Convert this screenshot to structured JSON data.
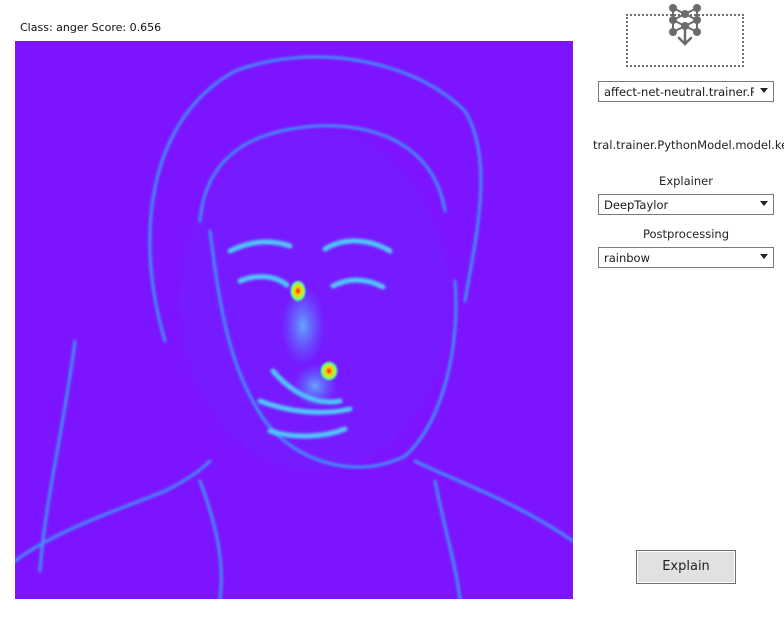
{
  "result": {
    "label": "Class: anger Score: 0.656"
  },
  "model_drop": {
    "icon": "neural-network-download-icon"
  },
  "model_select": {
    "value": "affect-net-neutral.trainer.Pyt"
  },
  "model_path": "tral.trainer.PythonModel.model.kera",
  "explainer": {
    "label": "Explainer",
    "value": "DeepTaylor"
  },
  "postprocessing": {
    "label": "Postprocessing",
    "value": "rainbow"
  },
  "explain_button": {
    "label": "Explain"
  },
  "colors": {
    "heatmap_background": "#7d14ff",
    "heatmap_edge": "#3aa0ff",
    "hotspot": "#ff2a00"
  }
}
